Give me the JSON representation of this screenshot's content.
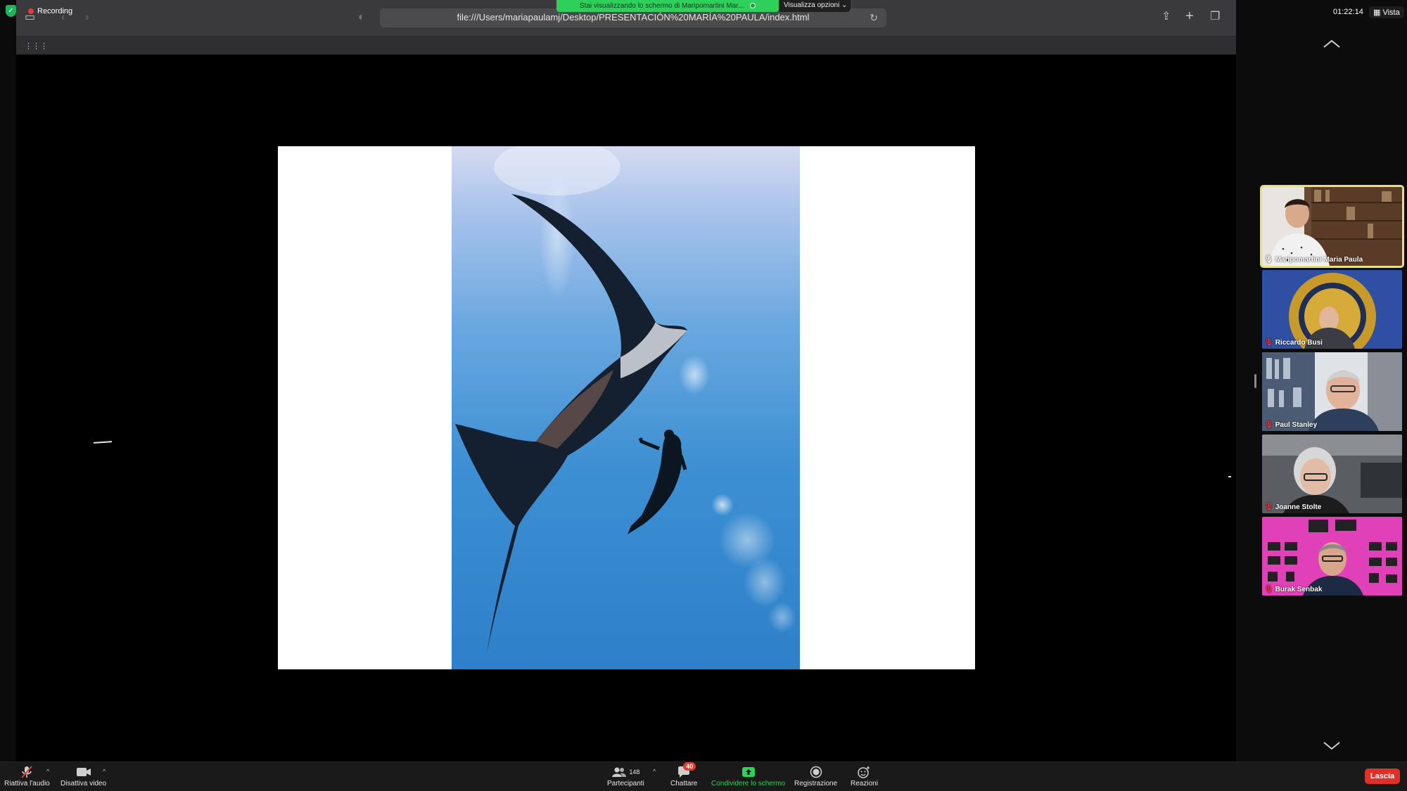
{
  "recording": {
    "label": "Recording"
  },
  "share_banner": {
    "text": "Stai visualizzando lo schermo di Maripomartini Mar...",
    "view_options": "Visualizza opzioni"
  },
  "browser": {
    "url": "file:///Users/mariapaulamj/Desktop/PRESENTACIÓN%20MARÍA%20PAULA/index.html"
  },
  "header": {
    "time": "01:22:14",
    "view_label": "Vista"
  },
  "participants": [
    {
      "name": "Maripomartini Maria Paula",
      "muted": false,
      "active": true
    },
    {
      "name": "Riccardo Busi",
      "muted": true,
      "active": false
    },
    {
      "name": "Paul Stanley",
      "muted": true,
      "active": false
    },
    {
      "name": "Joanne Stolte",
      "muted": true,
      "active": false
    },
    {
      "name": "Burak Senbak",
      "muted": true,
      "active": false
    }
  ],
  "toolbar": {
    "unmute": "Riattiva l'audio",
    "stop_video": "Disattiva video",
    "participants": "Partecipanti",
    "participants_count": "148",
    "chat": "Chattare",
    "chat_badge": "40",
    "share": "Condividere lo schermo",
    "record": "Registrazione",
    "reactions": "Reazioni",
    "leave": "Lascia"
  },
  "colors": {
    "share_green": "#30d158",
    "leave_red": "#e0302a",
    "active_speaker": "#e8e07a"
  }
}
